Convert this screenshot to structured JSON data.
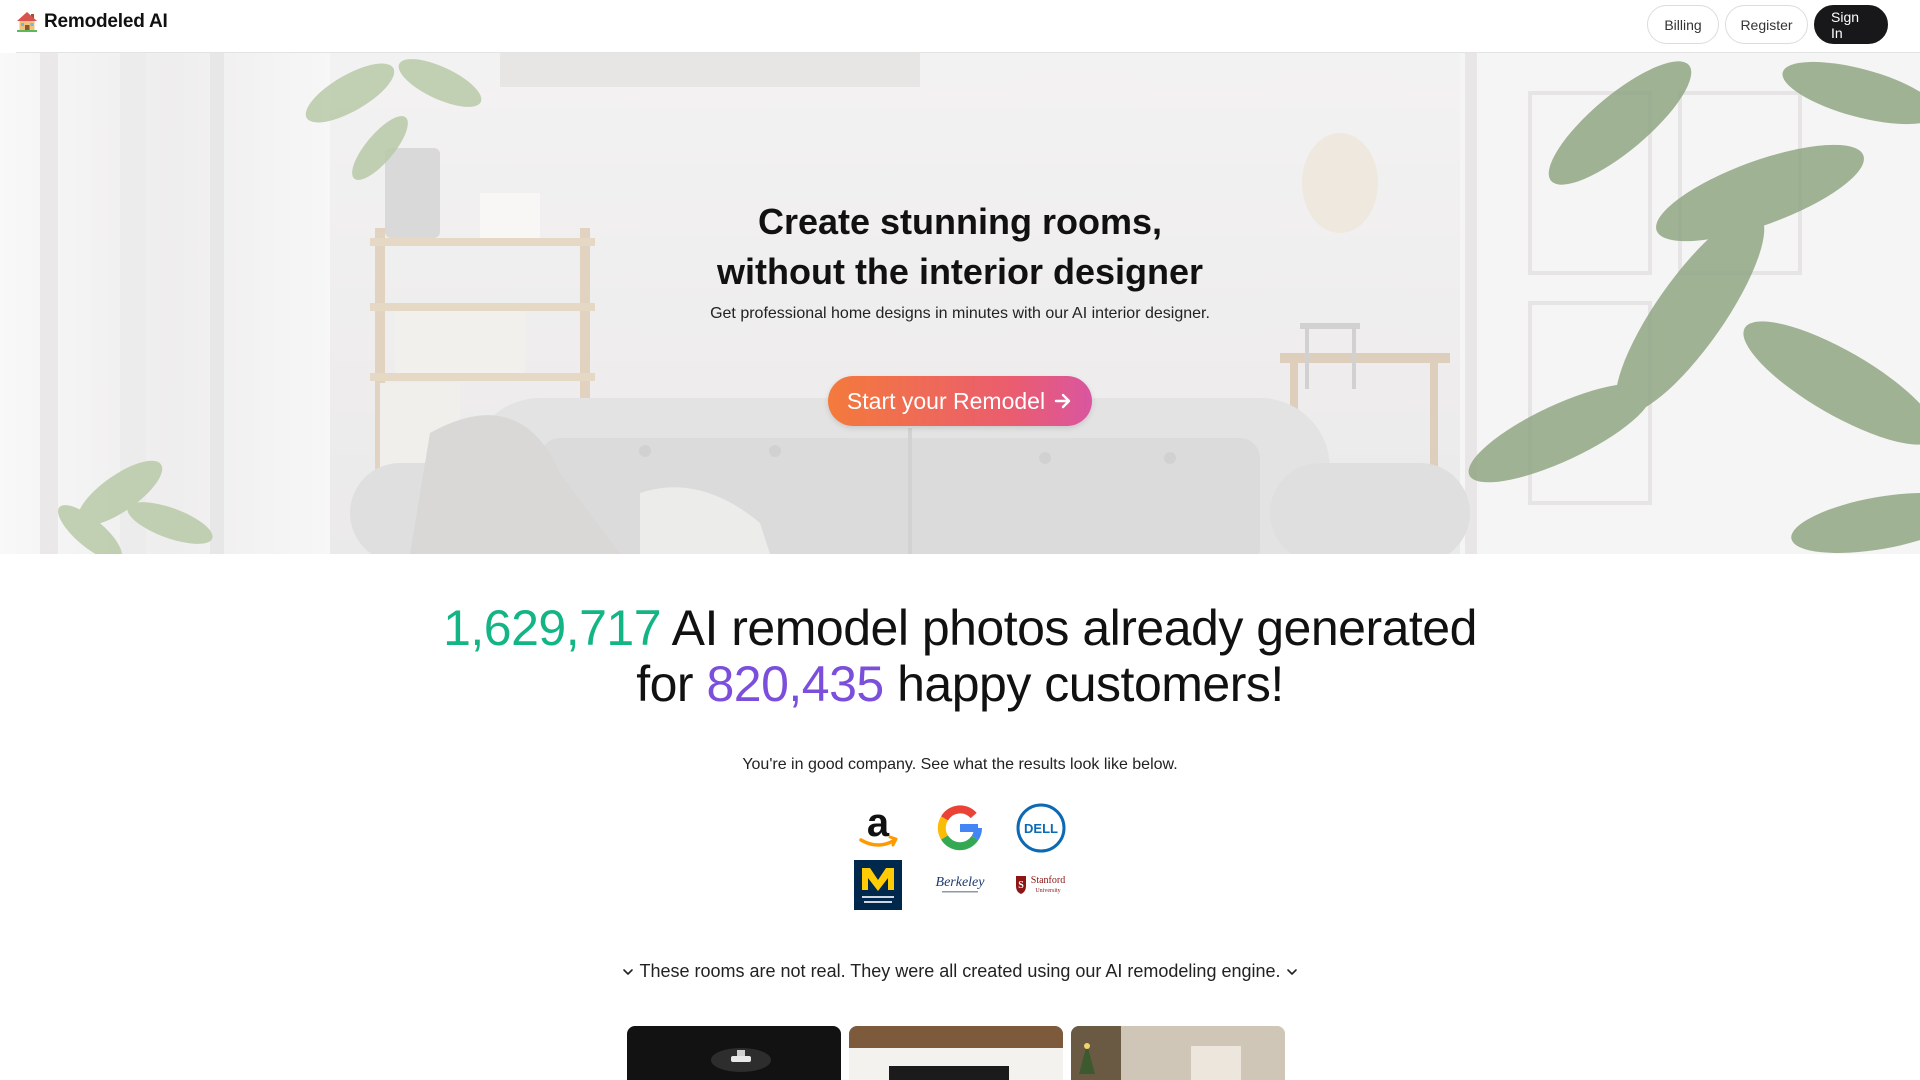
{
  "brand": {
    "name": "Remodeled AI",
    "logo_icon": "house-icon"
  },
  "nav": {
    "billing": "Billing",
    "register": "Register",
    "sign_in": "Sign In"
  },
  "hero": {
    "title_line1": "Create stunning rooms,",
    "title_line2": "without the interior designer",
    "subtitle": "Get professional home designs in minutes with our AI interior designer.",
    "cta_label": "Start your Remodel",
    "cta_icon": "arrow-right-icon"
  },
  "stats": {
    "photos_count": "1,629,717",
    "photos_text": " AI remodel photos already generated",
    "for_text": "for ",
    "customers_count": "820,435",
    "customers_text": " happy customers!"
  },
  "company_text": "You're in good company. See what the results look like below.",
  "logos": [
    "amazon-logo",
    "google-logo",
    "dell-logo",
    "university-of-michigan-logo",
    "berkeley-logo",
    "stanford-logo"
  ],
  "gallery_note": "These rooms are not real. They were all created using our AI remodeling engine.",
  "colors": {
    "accent_green": "#14b585",
    "accent_purple": "#7b4fdb",
    "cta_start": "#f47a3c",
    "cta_end": "#d956a0",
    "signin_bg": "#18181b"
  }
}
